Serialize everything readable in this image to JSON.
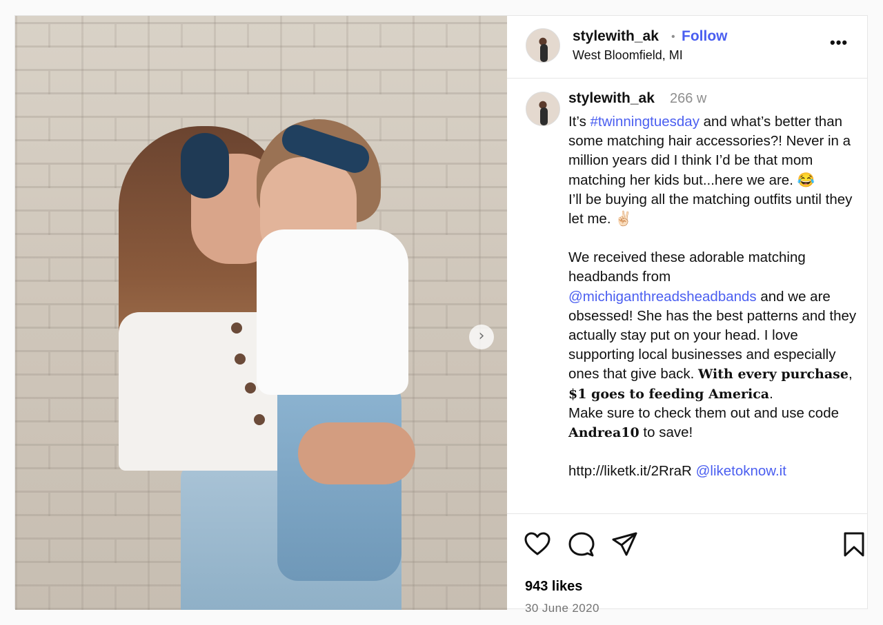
{
  "post": {
    "username": "stylewith_ak",
    "separator": "•",
    "follow_label": "Follow",
    "location": "West Bloomfield, MI",
    "more_label": "•••"
  },
  "caption": {
    "username": "stylewith_ak",
    "time_ago": "266 w",
    "line1_pre": "It’s ",
    "hashtag": "#twinningtuesday",
    "line1_post": " and what’s better than some matching hair accessories?! Never in a million years did I think I’d be that mom matching her kids but...here we are. 😂",
    "line2": "I’ll be buying all the matching outfits until they let me. ✌🏻",
    "line3_pre": "We received these adorable matching headbands from ",
    "mention": "@michiganthreadsheadbands",
    "line3_mid": " and we are obsessed! She has the best patterns and they actually stay put on your head. I love supporting local businesses and especially ones that give back. ",
    "bold1": "With every purchase",
    "comma": ", ",
    "bold2": "$1 goes to feeding America",
    "period": ".",
    "line4_pre": "Make sure to check them out and use code ",
    "code": "Andrea10",
    "line4_post": " to save!",
    "link": " http://liketk.it/2RraR",
    "mention2": "@liketoknow.it"
  },
  "footer": {
    "likes": "943 likes",
    "date": "30 June 2020"
  },
  "icons": {
    "like": "heart-icon",
    "comment": "comment-icon",
    "share": "share-icon",
    "save": "bookmark-icon",
    "next": "chevron-right-icon"
  },
  "colors": {
    "link": "#4a5ef0",
    "muted": "#8e8e8e",
    "border": "#e6e6e6"
  }
}
